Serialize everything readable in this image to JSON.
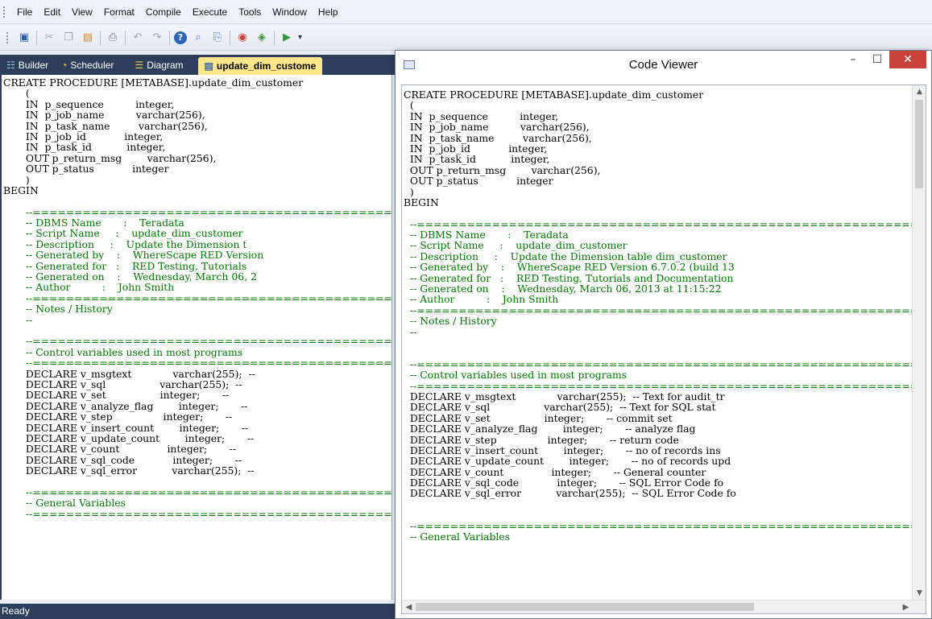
{
  "menu": [
    "File",
    "Edit",
    "View",
    "Format",
    "Compile",
    "Execute",
    "Tools",
    "Window",
    "Help"
  ],
  "toolbar": {
    "buttons": [
      "save-icon",
      "cut-icon",
      "copy-icon",
      "paste-icon",
      "print-icon",
      "undo-icon",
      "redo-icon",
      "help-icon",
      "find-icon",
      "replace-icon",
      "stop-icon",
      "run-icon",
      "play-icon"
    ],
    "dropdown": "▾"
  },
  "tabs": [
    {
      "label": "Builder",
      "icon": "grid-icon",
      "glyph": "☷"
    },
    {
      "label": "Scheduler",
      "icon": "clock-icon",
      "glyph": "◔"
    },
    {
      "label": "Diagram",
      "icon": "diagram-icon",
      "glyph": "☰"
    },
    {
      "label": "update_dim_custome",
      "icon": "document-icon",
      "glyph": "▤"
    }
  ],
  "status": "Ready",
  "colors": {
    "dark_chrome": "#2c3e5a",
    "active_tab": "#fbe58a",
    "comment": "#007a00",
    "close_button": "#c6423a"
  },
  "editor": {
    "lines": [
      {
        "t": "CREATE PROCEDURE [METABASE].update_dim_customer",
        "c": false,
        "x": -20
      },
      {
        "t": "  (",
        "c": false
      },
      {
        "t": "  IN  p_sequence          integer,",
        "c": false
      },
      {
        "t": "  IN  p_job_name          varchar(256),",
        "c": false
      },
      {
        "t": "  IN  p_task_name         varchar(256),",
        "c": false
      },
      {
        "t": "  IN  p_job_id            integer,",
        "c": false
      },
      {
        "t": "  IN  p_task_id           integer,",
        "c": false
      },
      {
        "t": "  OUT p_return_msg        varchar(256),",
        "c": false
      },
      {
        "t": "  OUT p_status            integer",
        "c": false
      },
      {
        "t": "  )",
        "c": false
      },
      {
        "t": "BEGIN",
        "c": false,
        "x": -20
      },
      {
        "t": "",
        "c": false
      },
      {
        "t": "  --================================================",
        "c": true
      },
      {
        "t": "  -- DBMS Name       :    Teradata",
        "c": true
      },
      {
        "t": "  -- Script Name     :    update_dim_customer",
        "c": true
      },
      {
        "t": "  -- Description     :    Update the Dimension t",
        "c": true
      },
      {
        "t": "  -- Generated by    :    WhereScape RED Version",
        "c": true
      },
      {
        "t": "  -- Generated for   :    RED Testing, Tutorials",
        "c": true
      },
      {
        "t": "  -- Generated on    :    Wednesday, March 06, 2",
        "c": true
      },
      {
        "t": "  -- Author          :    John Smith",
        "c": true
      },
      {
        "t": "  --================================================",
        "c": true
      },
      {
        "t": "  -- Notes / History",
        "c": true
      },
      {
        "t": "  --",
        "c": true
      },
      {
        "t": "",
        "c": false
      },
      {
        "t": "  --================================================",
        "c": true
      },
      {
        "t": "  -- Control variables used in most programs",
        "c": true
      },
      {
        "t": "  --================================================",
        "c": true
      },
      {
        "t": "  DECLARE v_msgtext             varchar(255);  --",
        "c": false
      },
      {
        "t": "  DECLARE v_sql                 varchar(255);  --",
        "c": false
      },
      {
        "t": "  DECLARE v_set                 integer;       --",
        "c": false
      },
      {
        "t": "  DECLARE v_analyze_flag        integer;       --",
        "c": false
      },
      {
        "t": "  DECLARE v_step                integer;       --",
        "c": false
      },
      {
        "t": "  DECLARE v_insert_count        integer;       --",
        "c": false
      },
      {
        "t": "  DECLARE v_update_count        integer;       --",
        "c": false
      },
      {
        "t": "  DECLARE v_count               integer;       --",
        "c": false
      },
      {
        "t": "  DECLARE v_sql_code            integer;       --",
        "c": false
      },
      {
        "t": "  DECLARE v_sql_error           varchar(255);  --",
        "c": false
      },
      {
        "t": "",
        "c": false
      },
      {
        "t": "  --================================================",
        "c": true
      },
      {
        "t": "  -- General Variables",
        "c": true
      },
      {
        "t": "  --================================================",
        "c": true
      }
    ]
  },
  "code_viewer": {
    "title": "Code Viewer",
    "buttons": {
      "minimize": "–",
      "maximize": "☐",
      "close": "✕"
    },
    "lines": [
      {
        "t": "CREATE PROCEDURE [METABASE].update_dim_customer",
        "c": false
      },
      {
        "t": "  (",
        "c": false
      },
      {
        "t": "  IN  p_sequence          integer,",
        "c": false
      },
      {
        "t": "  IN  p_job_name          varchar(256),",
        "c": false
      },
      {
        "t": "  IN  p_task_name         varchar(256),",
        "c": false
      },
      {
        "t": "  IN  p_job_id            integer,",
        "c": false
      },
      {
        "t": "  IN  p_task_id           integer,",
        "c": false
      },
      {
        "t": "  OUT p_return_msg        varchar(256),",
        "c": false
      },
      {
        "t": "  OUT p_status            integer",
        "c": false
      },
      {
        "t": "  )",
        "c": false
      },
      {
        "t": "BEGIN",
        "c": false
      },
      {
        "t": "",
        "c": false
      },
      {
        "t": "  --====================================================================",
        "c": true
      },
      {
        "t": "  -- DBMS Name       :    Teradata",
        "c": true
      },
      {
        "t": "  -- Script Name     :    update_dim_customer",
        "c": true
      },
      {
        "t": "  -- Description     :    Update the Dimension table dim_customer",
        "c": true
      },
      {
        "t": "  -- Generated by    :    WhereScape RED Version 6.7.0.2 (build 13",
        "c": true
      },
      {
        "t": "  -- Generated for   :    RED Testing, Tutorials and Documentation",
        "c": true
      },
      {
        "t": "  -- Generated on    :    Wednesday, March 06, 2013 at 11:15:22",
        "c": true
      },
      {
        "t": "  -- Author          :    John Smith",
        "c": true
      },
      {
        "t": "  --====================================================================",
        "c": true
      },
      {
        "t": "  -- Notes / History",
        "c": true
      },
      {
        "t": "  --",
        "c": true
      },
      {
        "t": "",
        "c": false
      },
      {
        "t": "",
        "c": false
      },
      {
        "t": "  --====================================================================",
        "c": true
      },
      {
        "t": "  -- Control variables used in most programs",
        "c": true
      },
      {
        "t": "  --====================================================================",
        "c": true
      },
      {
        "t": "  DECLARE v_msgtext             varchar(255);  -- Text for audit_tr",
        "c": false
      },
      {
        "t": "  DECLARE v_sql                 varchar(255);  -- Text for SQL stat",
        "c": false
      },
      {
        "t": "  DECLARE v_set                 integer;       -- commit set",
        "c": false
      },
      {
        "t": "  DECLARE v_analyze_flag        integer;       -- analyze flag",
        "c": false
      },
      {
        "t": "  DECLARE v_step                integer;       -- return code",
        "c": false
      },
      {
        "t": "  DECLARE v_insert_count        integer;       -- no of records ins",
        "c": false
      },
      {
        "t": "  DECLARE v_update_count        integer;       -- no of records upd",
        "c": false
      },
      {
        "t": "  DECLARE v_count               integer;       -- General counter",
        "c": false
      },
      {
        "t": "  DECLARE v_sql_code            integer;       -- SQL Error Code fo",
        "c": false
      },
      {
        "t": "  DECLARE v_sql_error           varchar(255);  -- SQL Error Code fo",
        "c": false
      },
      {
        "t": "",
        "c": false
      },
      {
        "t": "",
        "c": false
      },
      {
        "t": "  --====================================================================",
        "c": true
      },
      {
        "t": "  -- General Variables",
        "c": true
      }
    ]
  }
}
